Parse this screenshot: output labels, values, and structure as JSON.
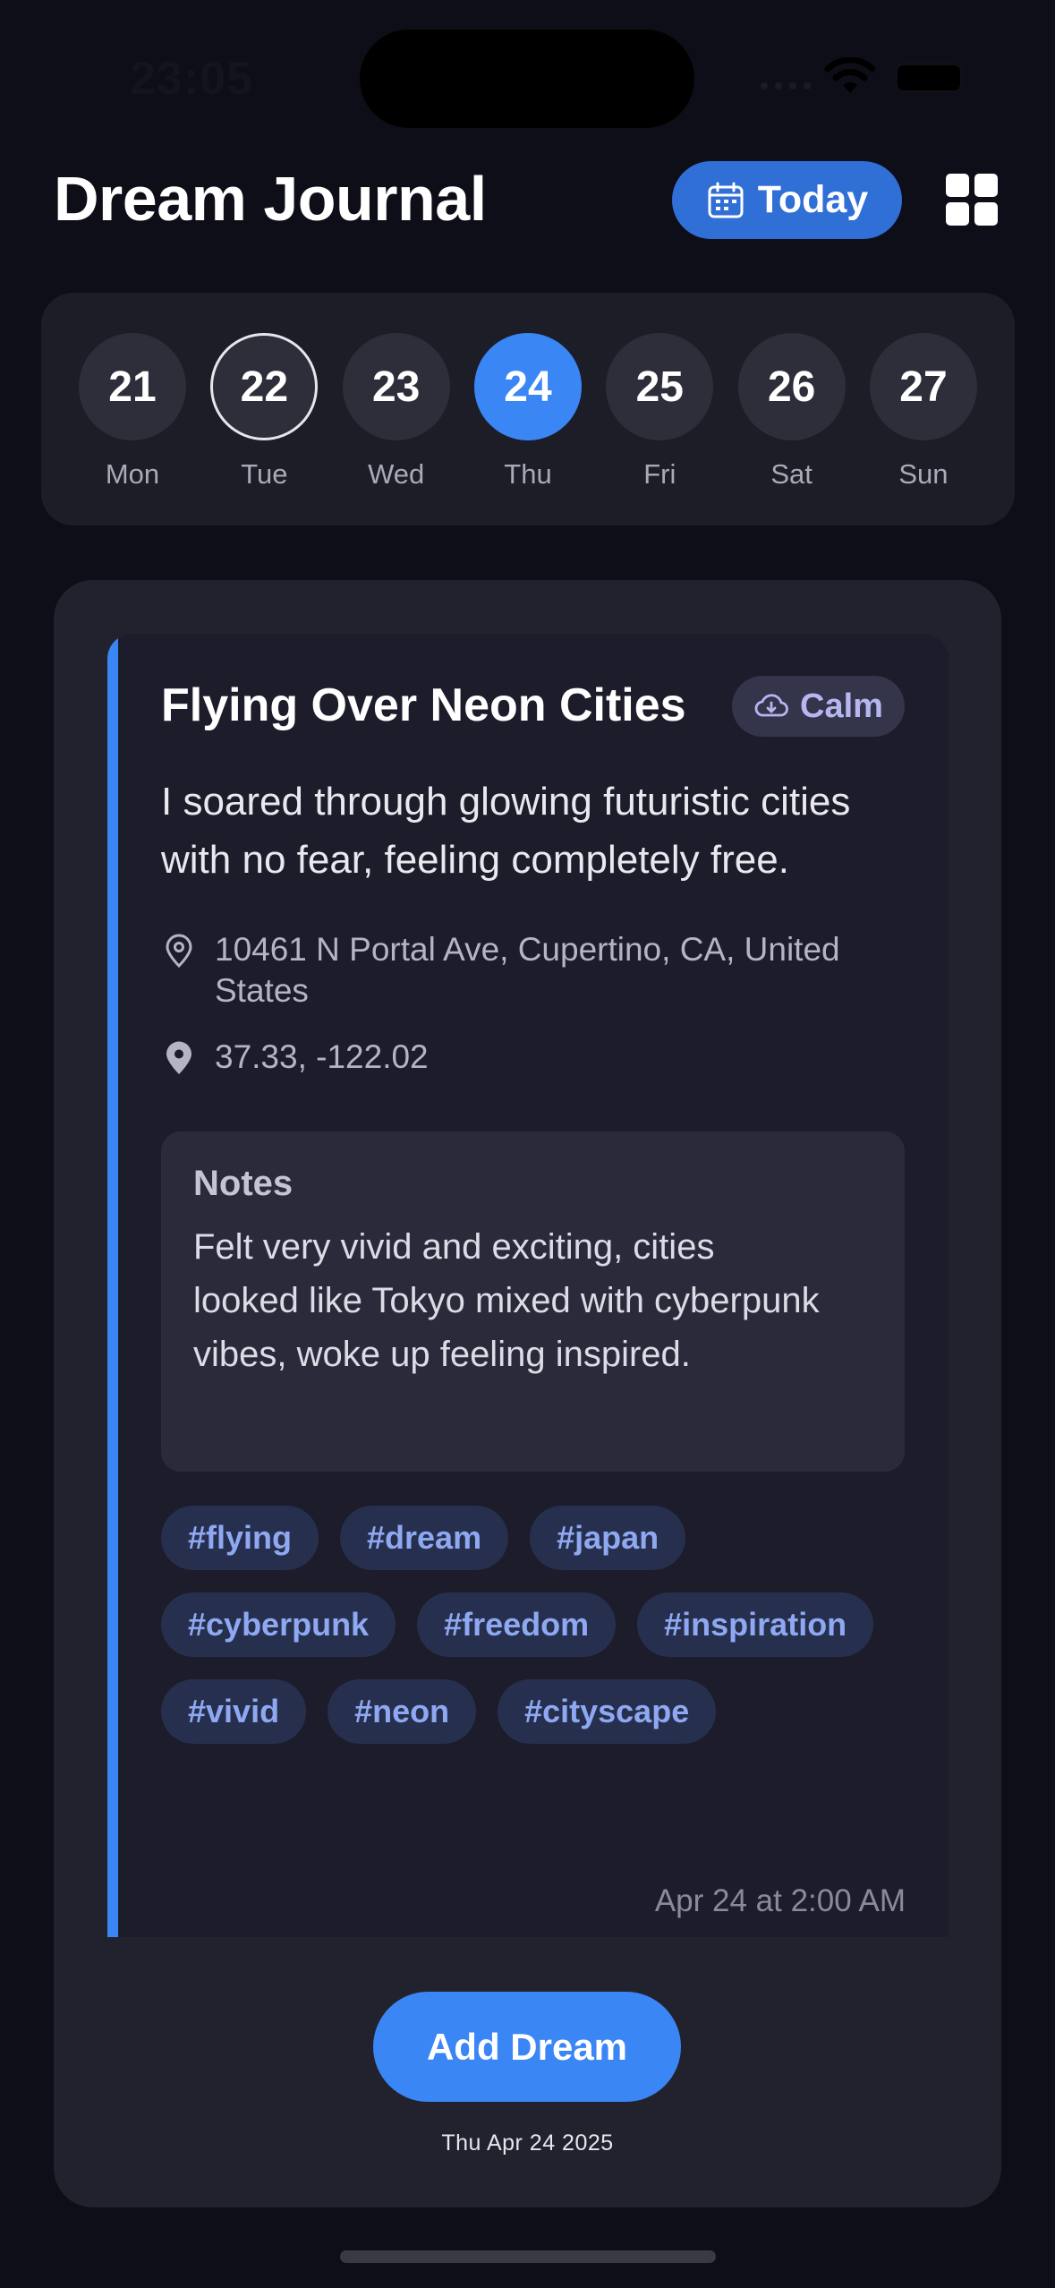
{
  "status_bar": {
    "time": "23:05"
  },
  "header": {
    "title": "Dream Journal",
    "today_label": "Today"
  },
  "week": [
    {
      "day": "21",
      "name": "Mon"
    },
    {
      "day": "22",
      "name": "Tue"
    },
    {
      "day": "23",
      "name": "Wed"
    },
    {
      "day": "24",
      "name": "Thu"
    },
    {
      "day": "25",
      "name": "Fri"
    },
    {
      "day": "26",
      "name": "Sat"
    },
    {
      "day": "27",
      "name": "Sun"
    }
  ],
  "dream": {
    "title": "Flying Over Neon Cities",
    "mood": "Calm",
    "description": "I soared through glowing futuristic cities with no fear, feeling completely free.",
    "address": "10461 N Portal Ave, Cupertino, CA, United States",
    "coordinates": "37.33, -122.02",
    "notes_heading": "Notes",
    "notes": "Felt very vivid and exciting, cities looked like Tokyo mixed with cyberpunk vibes, woke up feeling inspired.",
    "tags": [
      "#flying",
      "#dream",
      "#japan",
      "#cyberpunk",
      "#freedom",
      "#inspiration",
      "#vivid",
      "#neon",
      "#cityscape"
    ],
    "timestamp": "Apr 24 at 2:00 AM"
  },
  "footer": {
    "add_label": "Add Dream",
    "date_caption": "Thu Apr 24 2025"
  },
  "colors": {
    "accent": "#3a86f5",
    "today_button": "#2f6fd6",
    "background": "#0e0e18",
    "tag_text": "#8fa8f2"
  }
}
